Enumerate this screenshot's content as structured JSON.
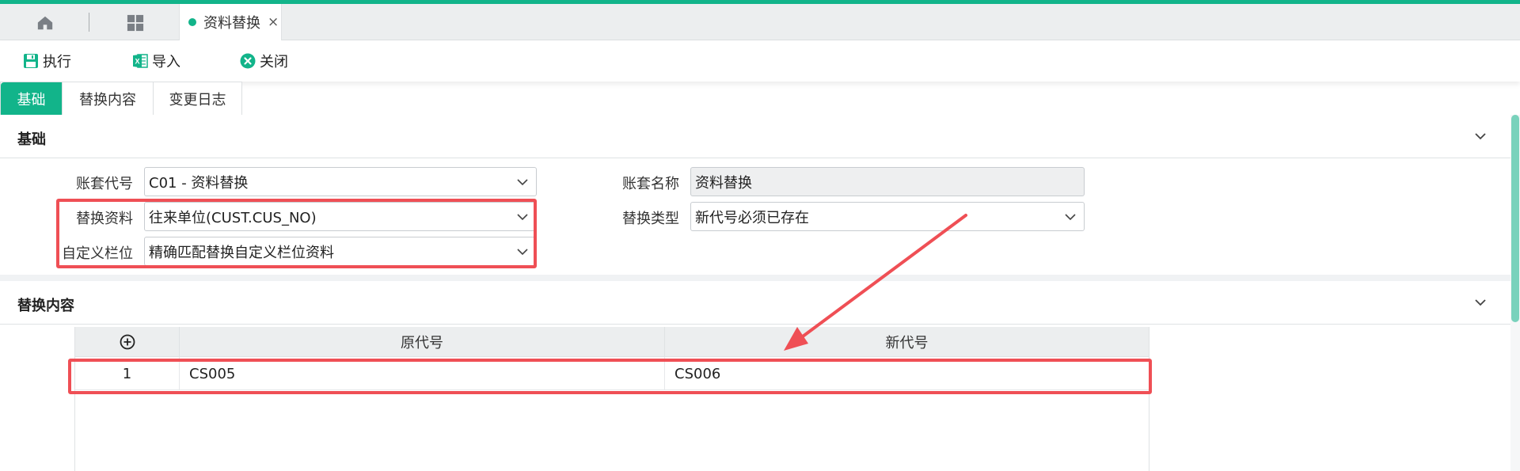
{
  "app": {
    "tab": {
      "label": "资料替换",
      "close": "×"
    }
  },
  "toolbar": {
    "execute": "执行",
    "import": "导入",
    "close": "关闭"
  },
  "subtabs": [
    "基础",
    "替换内容",
    "变更日志"
  ],
  "basic": {
    "title": "基础",
    "account_code": {
      "label": "账套代号",
      "value": "C01 - 资料替换"
    },
    "account_name": {
      "label": "账套名称",
      "value": "资料替换"
    },
    "replace_data": {
      "label": "替换资料",
      "value": "往来单位(CUST.CUS_NO)"
    },
    "replace_type": {
      "label": "替换类型",
      "value": "新代号必须已存在"
    },
    "custom_field": {
      "label": "自定义栏位",
      "value": "精确匹配替换自定义栏位资料"
    }
  },
  "content": {
    "title": "替换内容",
    "columns": [
      "原代号",
      "新代号"
    ],
    "rows": [
      {
        "index": "1",
        "old": "CS005",
        "new": "CS006"
      }
    ]
  },
  "colors": {
    "accent": "#12b48a",
    "highlight": "#ef4f55"
  }
}
